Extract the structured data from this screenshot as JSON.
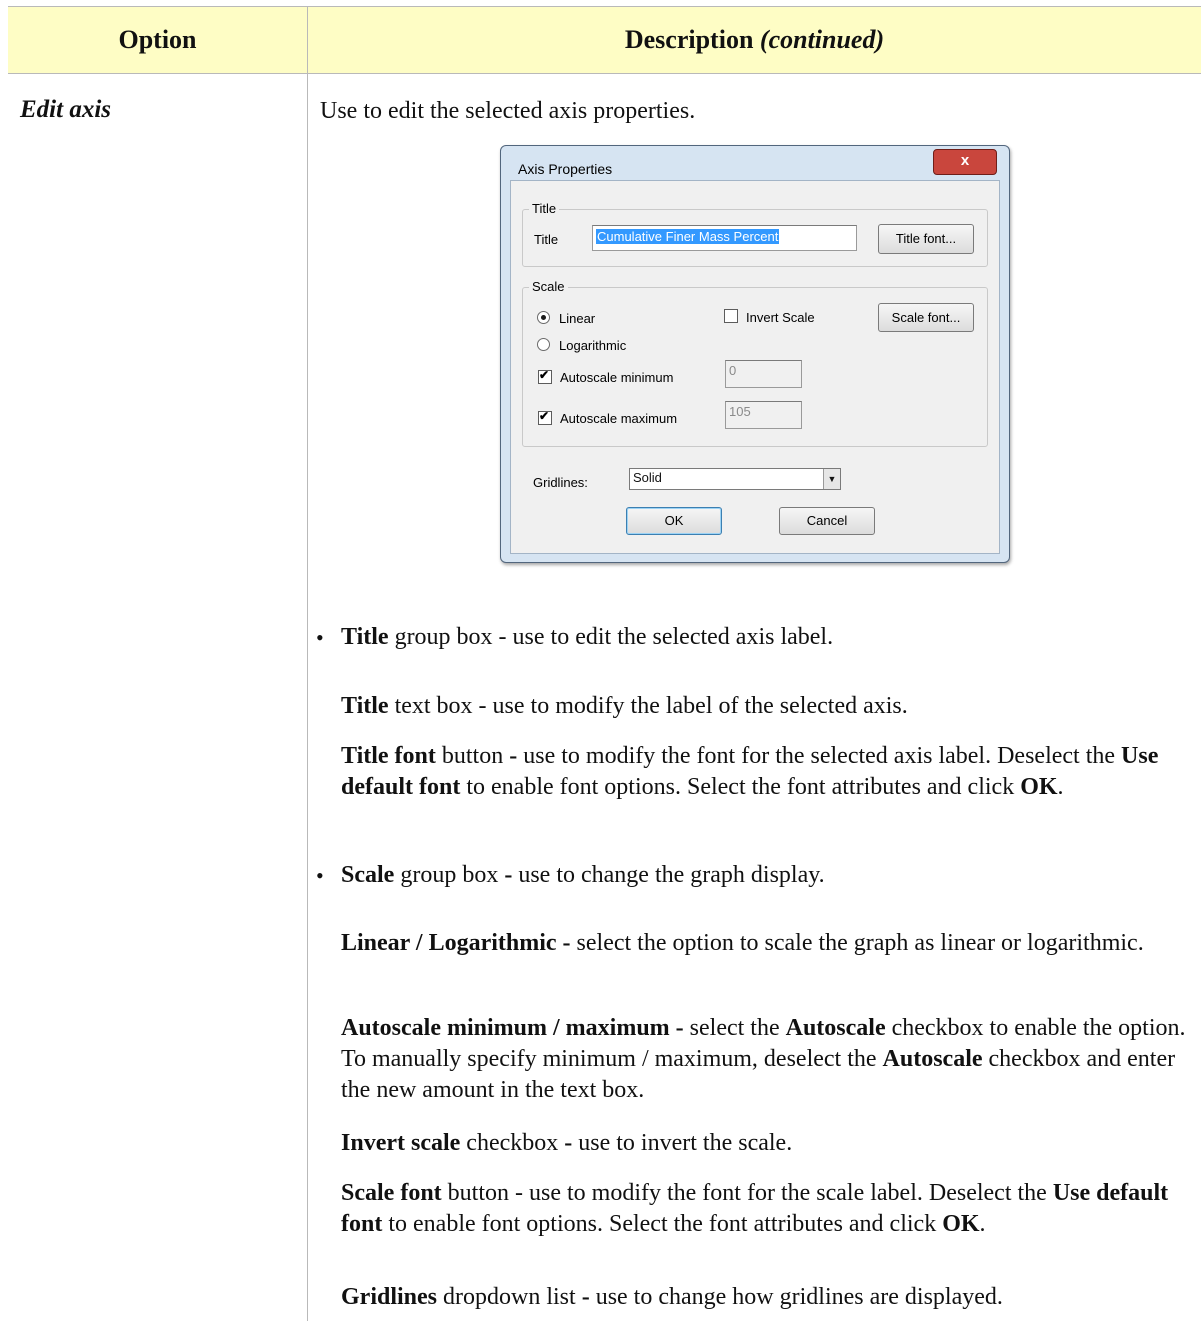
{
  "header": {
    "option": "Option",
    "description": "Description",
    "continued": "(continued)"
  },
  "option_name": "Edit axis",
  "intro": "Use to edit the selected axis properties.",
  "dialog": {
    "title": "Axis Properties",
    "close": "x",
    "title_group": "Title",
    "title_label": "Title",
    "title_value": "Cumulative Finer Mass Percent",
    "title_font_button": "Title font...",
    "scale_group": "Scale",
    "linear": "Linear",
    "logarithmic": "Logarithmic",
    "invert_scale": "Invert Scale",
    "scale_font_button": "Scale font...",
    "autoscale_minimum": "Autoscale minimum",
    "autoscale_minimum_value": "0",
    "autoscale_maximum": "Autoscale maximum",
    "autoscale_maximum_value": "105",
    "gridlines_label": "Gridlines:",
    "gridlines_value": "Solid",
    "ok": "OK",
    "cancel": "Cancel"
  },
  "body": {
    "p1_b": "Title",
    "p1_t": " group box - use to edit the selected axis label.",
    "p2_b": "Title",
    "p2_t": " text box - use to modify the label of the selected axis.",
    "p3_b1": "Title font",
    "p3_t1": " button ",
    "p3_b2": "-",
    "p3_t2": " use to modify the font for the selected axis label. Deselect the ",
    "p3_b3": "Use default font",
    "p3_t3": " to enable font options. Select the font attributes and click ",
    "p3_b4": "OK",
    "p3_t4": ".",
    "p4_b": "Scale",
    "p4_t1": " group box ",
    "p4_b2": "-",
    "p4_t2": " use to change the graph display.",
    "p5_b": "Linear / Logarithmic -",
    "p5_t": " select the option to scale the graph as linear or logarithmic.",
    "p6_b1": "Autoscale minimum / maximum -",
    "p6_t1": " select the ",
    "p6_b2": "Autoscale",
    "p6_t2": " checkbox to enable the option. To manually specify minimum / maximum, deselect the ",
    "p6_b3": "Autoscale",
    "p6_t3": " checkbox and enter the new amount in the text box.",
    "p7_b": "Invert scale",
    "p7_t1": " checkbox ",
    "p7_b2": "-",
    "p7_t2": " use to invert the scale.",
    "p8_b1": "Scale font",
    "p8_t1": " button - use to modify the font for the scale label. Deselect the ",
    "p8_b2": "Use default font",
    "p8_t2": " to enable font options. Select the font attributes and click ",
    "p8_b3": "OK",
    "p8_t3": ".",
    "p9_b": "Gridlines",
    "p9_t1": " dropdown list ",
    "p9_b2": "-",
    "p9_t2": " use to change how gridlines are displayed."
  }
}
